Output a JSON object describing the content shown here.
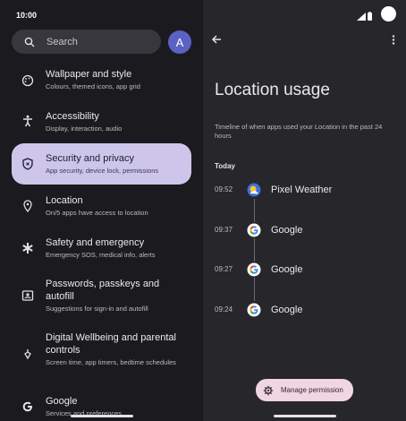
{
  "status": {
    "time": "10:00"
  },
  "search": {
    "placeholder": "Search"
  },
  "account": {
    "initial": "A"
  },
  "settings": [
    {
      "title": "Wallpaper and style",
      "subtitle": "Colours, themed icons, app grid",
      "icon": "palette-icon"
    },
    {
      "title": "Accessibility",
      "subtitle": "Display, interaction, audio",
      "icon": "accessibility-icon"
    },
    {
      "title": "Security and privacy",
      "subtitle": "App security, device lock, permissions",
      "icon": "shield-icon"
    },
    {
      "title": "Location",
      "subtitle": "On/5 apps have access to location",
      "icon": "location-pin-icon"
    },
    {
      "title": "Safety and emergency",
      "subtitle": "Emergency SOS, medical info, alerts",
      "icon": "asterisk-icon"
    },
    {
      "title": "Passwords, passkeys and autofill",
      "subtitle": "Suggestions for sign-in and autofill",
      "icon": "id-card-icon"
    },
    {
      "title": "Digital Wellbeing and parental controls",
      "subtitle": "Screen time, app timers, bedtime schedules",
      "icon": "wellbeing-icon"
    },
    {
      "title": "Google",
      "subtitle": "Services and preferences",
      "icon": "google-g-icon"
    }
  ],
  "detail": {
    "title": "Location usage",
    "description": "Timeline of when apps used your Location in the past 24 hours",
    "today_label": "Today",
    "timeline": [
      {
        "time": "09:52",
        "app": "Pixel Weather",
        "icon": "weather-icon"
      },
      {
        "time": "09:37",
        "app": "Google",
        "icon": "google-icon"
      },
      {
        "time": "09:27",
        "app": "Google",
        "icon": "google-icon"
      },
      {
        "time": "09:24",
        "app": "Google",
        "icon": "google-icon"
      }
    ],
    "manage_label": "Manage permission"
  },
  "colors": {
    "selected": "#cdc6ea",
    "fab": "#f0d6e0",
    "accent": "#5b62c5"
  }
}
